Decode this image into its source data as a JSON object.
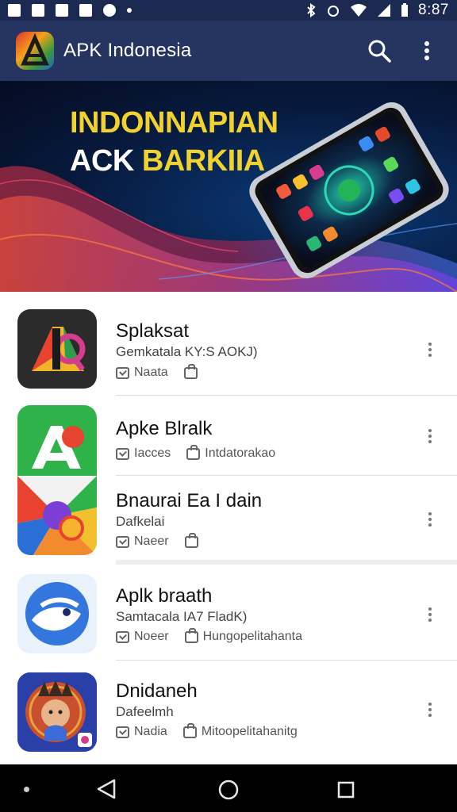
{
  "status_bar": {
    "time": "8:87"
  },
  "app_bar": {
    "title": "APK Indonesia",
    "search_icon": "search-icon",
    "more_icon": "more-vert-icon"
  },
  "banner": {
    "line1": "INDONNAPIAN",
    "line2_white": "ACK",
    "line2_yellow": "BARKIIA"
  },
  "items": [
    {
      "title": "Splaksat",
      "subtitle": "Gemkatala KY:S AOKJ)",
      "meta1": "Naata",
      "meta2": ""
    },
    {
      "title": "Apke Blralk",
      "subtitle": "",
      "meta1": "Iacces",
      "meta2": "Intdatorakao"
    },
    {
      "title": "Bnaurai Ea I dain",
      "subtitle": "Dafkelai",
      "meta1": "Naeer",
      "meta2": ""
    },
    {
      "title": "Aplk braath",
      "subtitle": "Samtacala IA7 FladK)",
      "meta1": "Noeer",
      "meta2": "Hungopelitahanta"
    },
    {
      "title": "Dnidaneh",
      "subtitle": "Dafeelmh",
      "meta1": "Nadia",
      "meta2": "Mitoopelitahanitg"
    }
  ],
  "colors": {
    "status_bar": "#1c2a52",
    "app_bar": "#253461",
    "banner_text_yellow": "#f2d22e"
  }
}
